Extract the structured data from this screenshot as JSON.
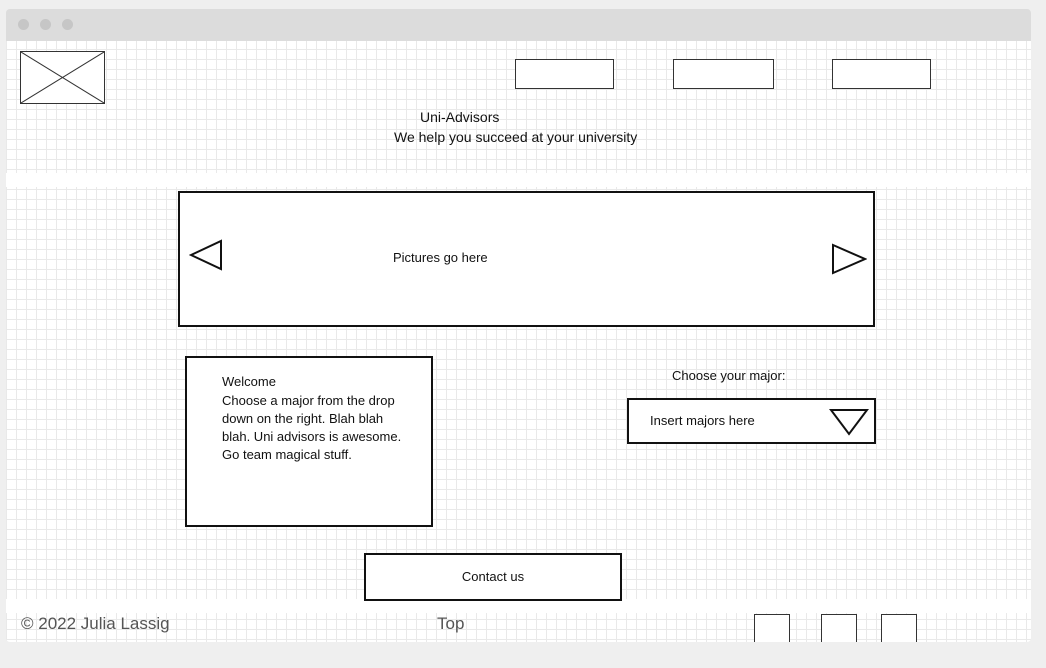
{
  "header": {
    "title": "Uni-Advisors",
    "tagline": "We help you succeed at your university",
    "logo_icon": "image-placeholder-icon",
    "nav_buttons": [
      "",
      "",
      ""
    ]
  },
  "carousel": {
    "placeholder": "Pictures go here",
    "prev_icon": "triangle-left-icon",
    "next_icon": "triangle-right-icon"
  },
  "welcome": {
    "heading": "Welcome",
    "text": "Choose a major from the drop down on the right. Blah blah blah. Uni advisors is awesome. Go team magical stuff."
  },
  "major_select": {
    "label": "Choose your major:",
    "value": "Insert majors here",
    "caret_icon": "triangle-down-icon"
  },
  "contact": {
    "label": "Contact us"
  },
  "footer": {
    "copyright": "© 2022 Julia Lassig",
    "top_link": "Top",
    "social_buttons": [
      "",
      "",
      ""
    ]
  },
  "colors": {
    "stroke": "#111111",
    "grid_minor": "#e9e9e9",
    "grid_major": "#d2d2d2",
    "titlebar": "#dcdcdc"
  }
}
